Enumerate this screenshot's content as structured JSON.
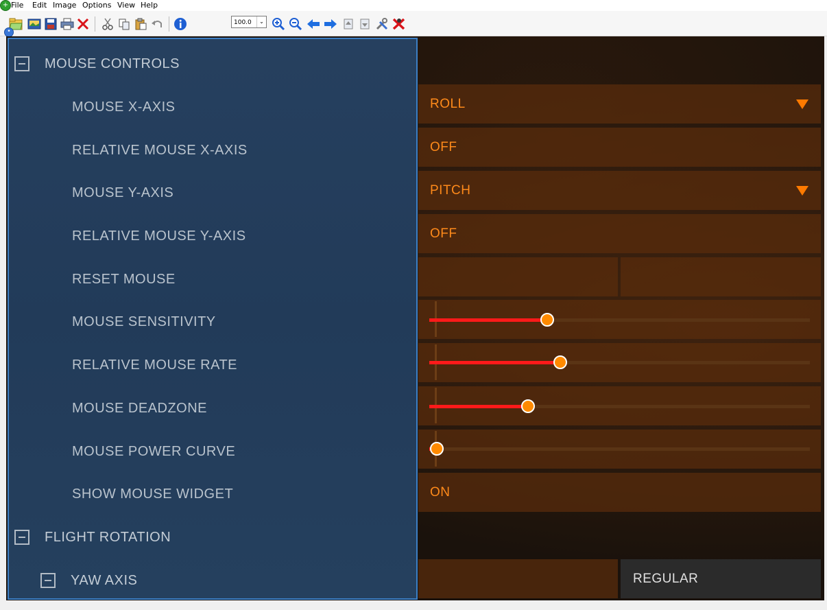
{
  "menu": [
    "File",
    "Edit",
    "Image",
    "Options",
    "View",
    "Help"
  ],
  "toolbar": {
    "zoom_value": "100.0",
    "icons": [
      "open-folder-icon",
      "image-icon",
      "save-icon",
      "print-icon",
      "delete-icon",
      "cut-icon",
      "copy-icon",
      "paste-icon",
      "undo-icon",
      "info-icon",
      "zoom-in-icon",
      "zoom-out-icon",
      "arrow-left-icon",
      "arrow-right-icon",
      "page-up-icon",
      "page-down-icon",
      "tools-icon",
      "exit-icon"
    ]
  },
  "sections": {
    "mouse_controls": "MOUSE CONTROLS",
    "flight_rotation": "FLIGHT ROTATION",
    "yaw_axis": "YAW AXIS"
  },
  "settings": [
    {
      "label": "MOUSE X-AXIS",
      "value": "ROLL",
      "dropdown": true
    },
    {
      "label": "RELATIVE MOUSE X-AXIS",
      "value": "OFF"
    },
    {
      "label": "MOUSE Y-AXIS",
      "value": "PITCH",
      "dropdown": true
    },
    {
      "label": "RELATIVE MOUSE Y-AXIS",
      "value": "OFF"
    },
    {
      "label": "RESET MOUSE"
    },
    {
      "label": "MOUSE SENSITIVITY",
      "slider": 0.31
    },
    {
      "label": "RELATIVE MOUSE RATE",
      "slider": 0.345
    },
    {
      "label": "MOUSE DEADZONE",
      "slider": 0.26
    },
    {
      "label": "MOUSE POWER CURVE",
      "slider": 0.02
    },
    {
      "label": "SHOW MOUSE WIDGET",
      "value": "ON"
    }
  ],
  "yaw_axis_value": "REGULAR",
  "colors": {
    "panel_blue": "#223b59",
    "accent_orange": "#ff8a1a",
    "slider_red": "#ff1a1a",
    "highlight_border": "#3d7fc4"
  }
}
